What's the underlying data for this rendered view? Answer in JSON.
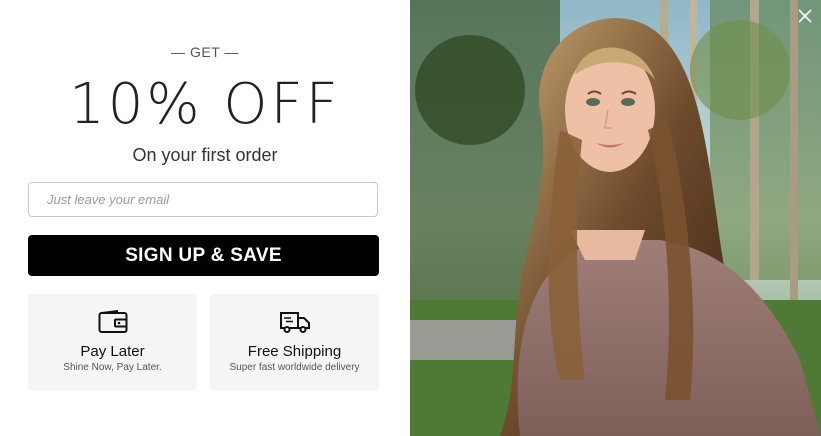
{
  "popup": {
    "eyebrow": "— GET —",
    "headline": "10% OFF",
    "subheadline": "On your first order",
    "email": {
      "placeholder": "Just leave your email",
      "value": ""
    },
    "cta_label": "SIGN UP & SAVE",
    "features": [
      {
        "icon": "wallet-icon",
        "title": "Pay Later",
        "desc": "Shine Now, Pay Later."
      },
      {
        "icon": "truck-icon",
        "title": "Free Shipping",
        "desc": "Super fast worldwide delivery"
      }
    ],
    "close_icon": "close-icon",
    "photo": {
      "content": "woman with long highlighted brown hair in mauve top, outdoors among palm trees"
    }
  },
  "colors": {
    "cta_bg": "#000000",
    "card_bg": "#f5f5f5",
    "border": "#c8c8c8"
  }
}
